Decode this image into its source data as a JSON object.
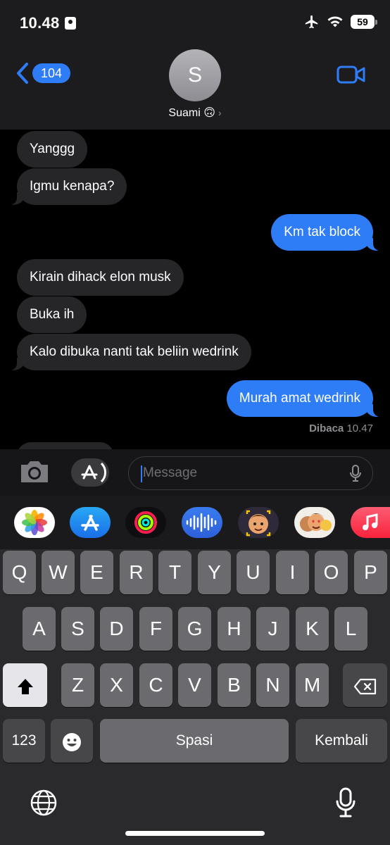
{
  "status": {
    "time": "10.48",
    "battery": "59"
  },
  "header": {
    "back_count": "104",
    "avatar_initial": "S",
    "contact_name": "Suami 🙃"
  },
  "messages": [
    {
      "text": "Yanggg",
      "dir": "in"
    },
    {
      "text": "Igmu kenapa?",
      "dir": "in"
    },
    {
      "text": "Km tak block",
      "dir": "out"
    },
    {
      "text": "Kirain dihack elon musk",
      "dir": "in"
    },
    {
      "text": "Buka ih",
      "dir": "in"
    },
    {
      "text": "Kalo dibuka nanti tak beliin wedrink",
      "dir": "in"
    },
    {
      "text": "Murah amat wedrink",
      "dir": "out"
    }
  ],
  "receipt": {
    "label": "Dibaca",
    "time": "10.47"
  },
  "input": {
    "placeholder": "Message"
  },
  "apps": [
    "photos-icon",
    "app-store-icon",
    "activity-icon",
    "audio-message-icon",
    "memoji-icon",
    "memoji-stickers-icon",
    "music-icon"
  ],
  "keyboard": {
    "row1": [
      "Q",
      "W",
      "E",
      "R",
      "T",
      "Y",
      "U",
      "I",
      "O",
      "P"
    ],
    "row2": [
      "A",
      "S",
      "D",
      "F",
      "G",
      "H",
      "J",
      "K",
      "L"
    ],
    "row3": [
      "Z",
      "X",
      "C",
      "V",
      "B",
      "N",
      "M"
    ],
    "numbers_label": "123",
    "space_label": "Spasi",
    "return_label": "Kembali"
  },
  "colors": {
    "accent": "#2f7df6",
    "incoming_bubble": "#262629",
    "background": "#000000"
  }
}
